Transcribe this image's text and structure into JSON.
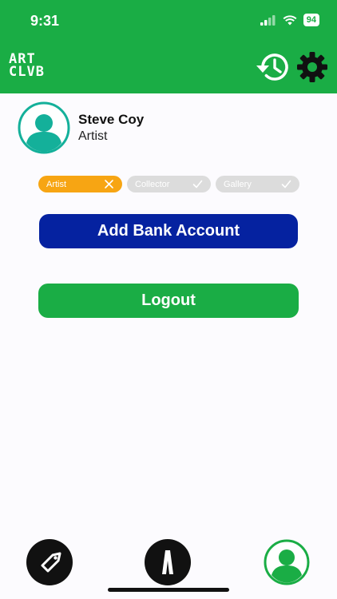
{
  "status_bar": {
    "time": "9:31",
    "battery": "94"
  },
  "header": {
    "logo_line1": "ART",
    "logo_line2": "CLVB"
  },
  "profile": {
    "name": "Steve Coy",
    "role": "Artist"
  },
  "roles": [
    {
      "label": "Artist",
      "selected": true
    },
    {
      "label": "Collector",
      "selected": false
    },
    {
      "label": "Gallery",
      "selected": false
    }
  ],
  "actions": {
    "add_bank": "Add Bank Account",
    "logout": "Logout"
  },
  "colors": {
    "brand_green": "#1aad45",
    "bank_blue": "#0522a0",
    "active_chip": "#f7a513",
    "avatar_teal": "#14b09a"
  },
  "icons": {
    "history": "history-icon",
    "settings": "gear-icon",
    "tag": "tag-icon",
    "home": "art-clvb-logo-icon",
    "profile": "person-icon"
  }
}
